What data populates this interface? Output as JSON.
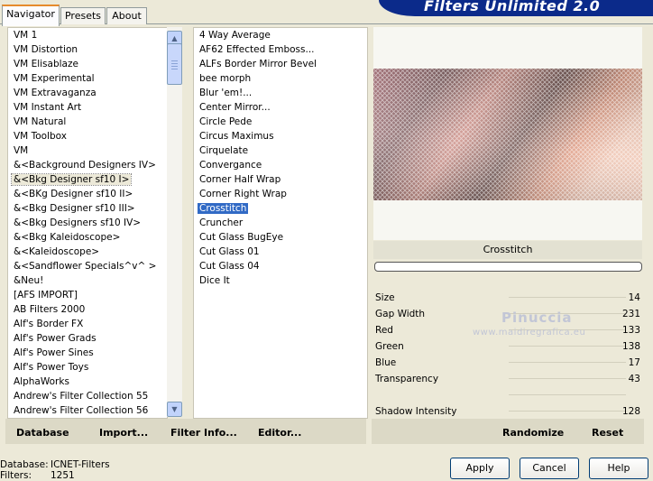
{
  "tabs": [
    "Navigator",
    "Presets",
    "About"
  ],
  "banner_title": "Filters Unlimited 2.0",
  "categories": [
    "VM 1",
    "VM Distortion",
    "VM Elisablaze",
    "VM Experimental",
    "VM Extravaganza",
    "VM Instant Art",
    "VM Natural",
    "VM Toolbox",
    "VM",
    "&<Background Designers IV>",
    "&<Bkg Designer sf10 I>",
    "&<BKg Designer sf10 II>",
    "&<Bkg Designer sf10 III>",
    "&<Bkg Designers sf10 IV>",
    "&<Bkg Kaleidoscope>",
    "&<Kaleidoscope>",
    "&<Sandflower Specials^v^ >",
    "&Neu!",
    "[AFS IMPORT]",
    "AB Filters 2000",
    "Alf's Border FX",
    "Alf's Power Grads",
    "Alf's Power Sines",
    "Alf's Power Toys",
    "AlphaWorks",
    "Andrew's Filter Collection 55",
    "Andrew's Filter Collection 56"
  ],
  "filters": [
    "4 Way Average",
    "AF62 Effected Emboss...",
    "ALFs Border Mirror Bevel",
    "bee morph",
    "Blur 'em!...",
    "Center Mirror...",
    "Circle Pede",
    "Circus Maximus",
    "Cirquelate",
    "Convergance",
    "Corner Half Wrap",
    "Corner Right Wrap",
    "Crosstitch",
    "Cruncher",
    "Cut Glass  BugEye",
    "Cut Glass 01",
    "Cut Glass 04",
    "Dice It"
  ],
  "selected_category": "&<Bkg Designer sf10 I>",
  "selected_filter": "Crosstitch",
  "bottom_buttons": {
    "database": "Database",
    "import": "Import...",
    "filter_info": "Filter Info...",
    "editor": "Editor..."
  },
  "filter_name": "Crosstitch",
  "params": [
    {
      "label": "Size",
      "value": "14"
    },
    {
      "label": "Gap Width",
      "value": "231"
    },
    {
      "label": "Red",
      "value": "133"
    },
    {
      "label": "Green",
      "value": "138"
    },
    {
      "label": "Blue",
      "value": "17"
    },
    {
      "label": "Transparency",
      "value": "43"
    },
    {
      "label": "",
      "value": ""
    },
    {
      "label": "Shadow Intensity",
      "value": "128"
    }
  ],
  "watermark": {
    "name": "Pinuccia",
    "site": "www.maidiregrafica.eu"
  },
  "randomize_label": "Randomize",
  "reset_label": "Reset",
  "status": {
    "database_label": "Database:",
    "database_value": "ICNET-Filters",
    "filters_label": "Filters:",
    "filters_value": "1251"
  },
  "dialog": {
    "apply": "Apply",
    "cancel": "Cancel",
    "help": "Help"
  },
  "colors": {
    "selection": "#316ac5",
    "banner": "#0b2a8a",
    "tab_accent": "#e68b2c"
  }
}
